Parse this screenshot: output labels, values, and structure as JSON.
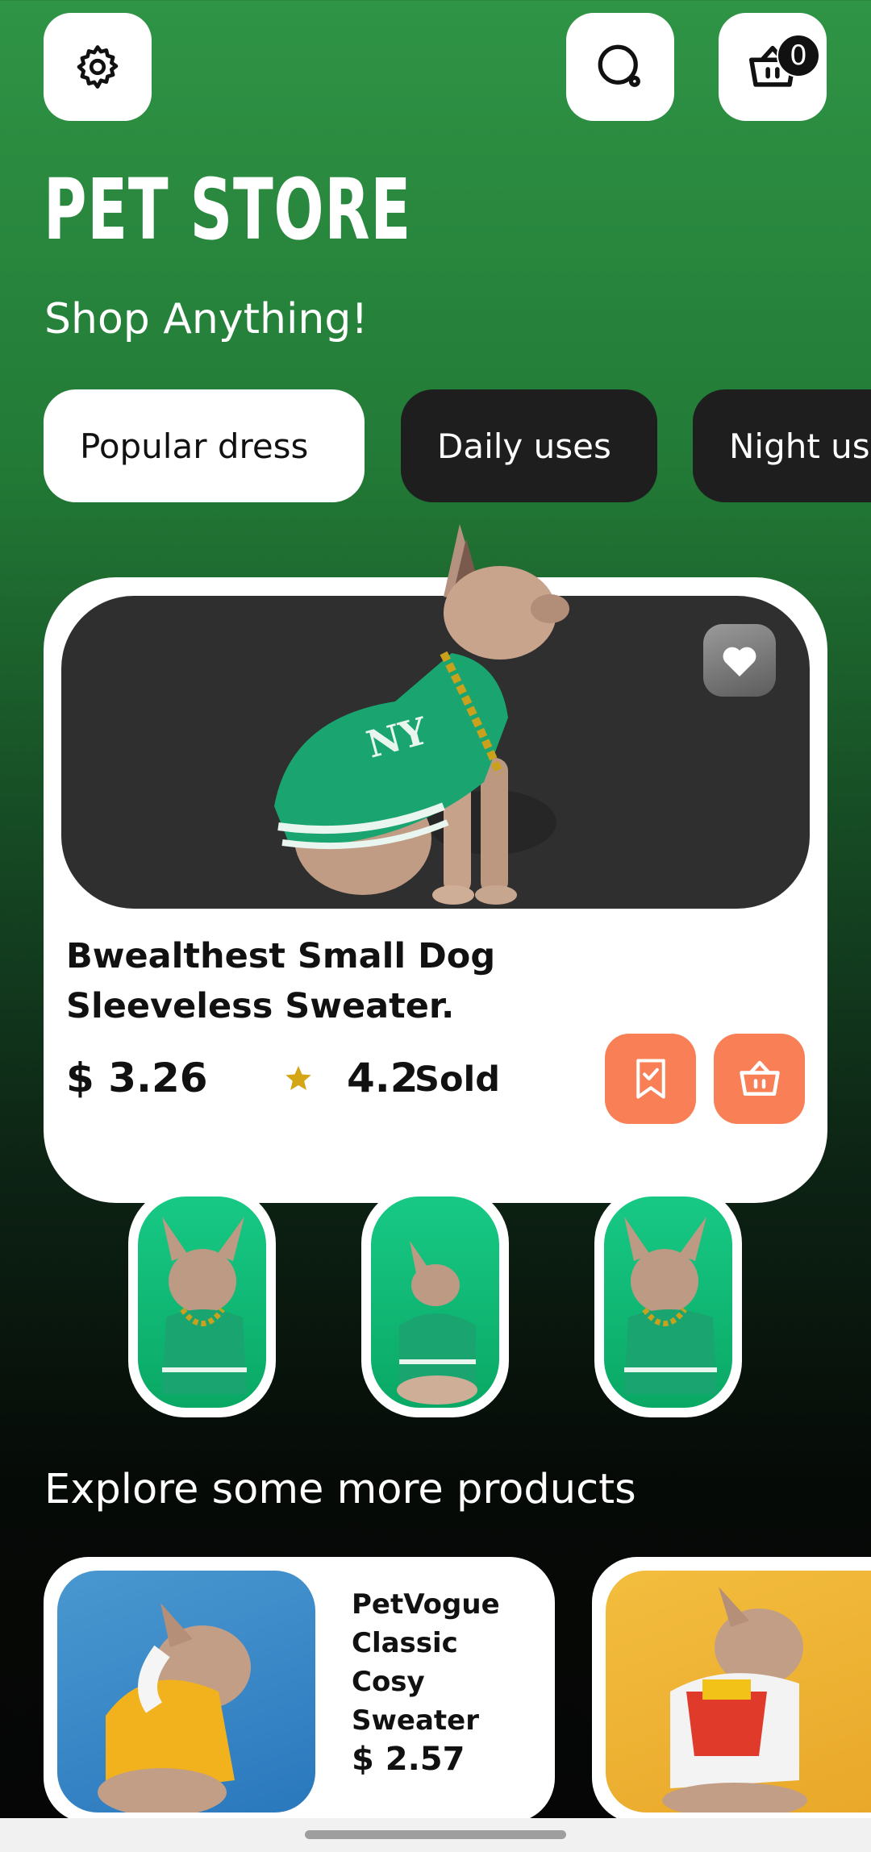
{
  "header": {
    "settings_icon": "gear-icon",
    "search_icon": "search-icon",
    "cart_icon": "basket-icon",
    "cart_count": "0"
  },
  "title": "PET STORE",
  "subtitle": "Shop Anything!",
  "categories": [
    "Popular dress",
    "Daily uses",
    "Night us"
  ],
  "featured": {
    "name_line1": "Bwealthest Small Dog",
    "name_line2": "Sleeveless Sweater.",
    "price": "$ 3.26",
    "rating": "4.2",
    "sold_label": "Sold",
    "colors": {
      "accent": "#f87f56",
      "star": "#d4a514",
      "hero_bg": "#2f2f2f"
    }
  },
  "section_title": "Explore some more products",
  "products": [
    {
      "name_lines": [
        "PetVogue",
        "Classic",
        "Cosy",
        "Sweater"
      ],
      "price": "$ 2.57"
    }
  ]
}
